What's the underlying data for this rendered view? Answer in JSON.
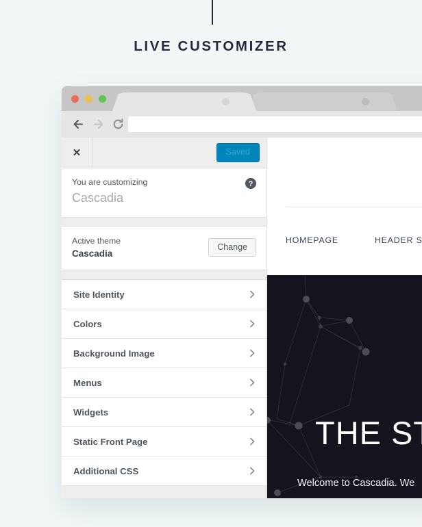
{
  "page": {
    "background_color": "#f1f7f7",
    "section_title": "LIVE CUSTOMIZER"
  },
  "browser": {
    "traffic_lights": [
      {
        "name": "close",
        "color": "#ed6a5e"
      },
      {
        "name": "minimize",
        "color": "#e8c252"
      },
      {
        "name": "maximize",
        "color": "#61c454"
      }
    ],
    "tabs": [
      {
        "label": "",
        "active": true
      },
      {
        "label": "",
        "active": false
      }
    ],
    "toolbar": {
      "back_icon": "back-arrow-icon",
      "forward_icon": "forward-arrow-icon",
      "reload_icon": "reload-icon",
      "url_value": "",
      "url_placeholder": ""
    }
  },
  "customizer": {
    "close_label": "✕",
    "save_label": "Saved",
    "save_bg": "#0085ba",
    "save_text_color": "#2fa8d4",
    "customizing_label": "You are customizing",
    "customizing_theme": "Cascadia",
    "help_icon": "help-circle-icon",
    "active_theme_label": "Active theme",
    "active_theme_name": "Cascadia",
    "change_label": "Change",
    "sections": [
      {
        "label": "Site Identity"
      },
      {
        "label": "Colors"
      },
      {
        "label": "Background Image"
      },
      {
        "label": "Menus"
      },
      {
        "label": "Widgets"
      },
      {
        "label": "Static Front Page"
      },
      {
        "label": "Additional CSS"
      }
    ]
  },
  "preview": {
    "nav_links": [
      {
        "label": "HOMEPAGE"
      },
      {
        "label": "HEADER STYLES"
      }
    ],
    "hero": {
      "background_color": "#14141f",
      "title": "THE STARS",
      "subtitle": "Welcome to Cascadia. We"
    }
  }
}
